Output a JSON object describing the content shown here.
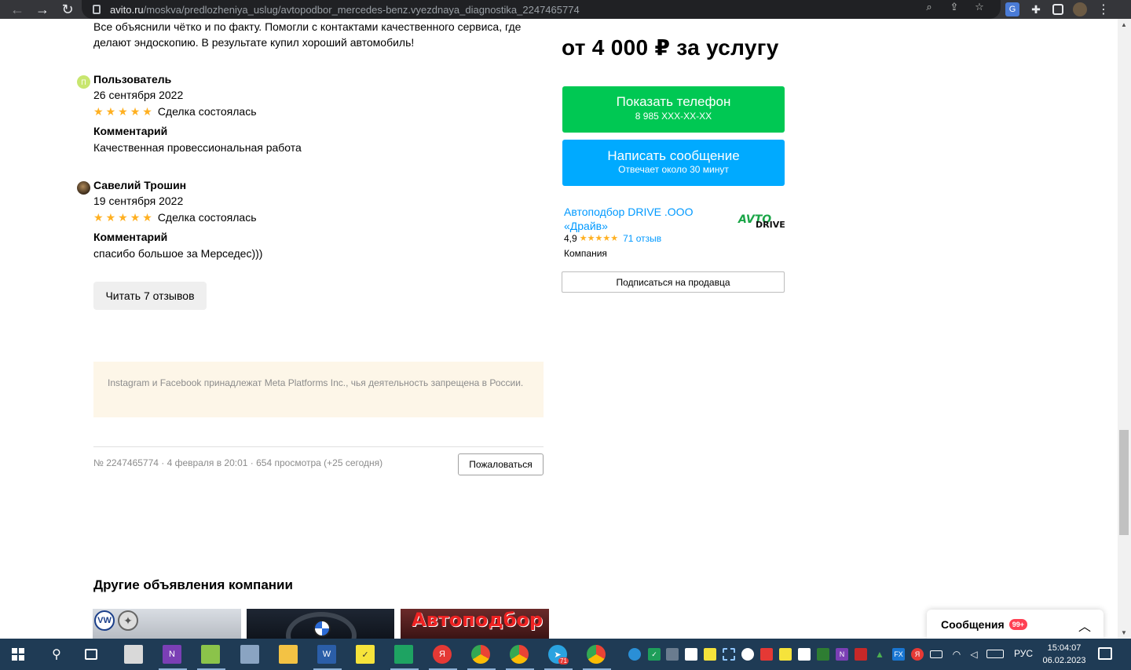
{
  "browser": {
    "url_host": "avito.ru",
    "url_path": "/moskva/predlozheniya_uslug/avtopodbor_mercedes-benz.vyezdnaya_diagnostika_2247465774"
  },
  "reviews": {
    "intro_text": "Все объяснили чётко и по факту. Помогли с контактами качественного сервиса, где делают эндоскопию. В результате купил хороший автомобиль!",
    "items": [
      {
        "avatar_letter": "П",
        "author": "Пользователь",
        "date": "26 сентября 2022",
        "deal": "Сделка состоялась",
        "comment_heading": "Комментарий",
        "comment": "Качественная провессиональная работа"
      },
      {
        "author": "Савелий Трошин",
        "date": "19 сентября 2022",
        "deal": "Сделка состоялась",
        "comment_heading": "Комментарий",
        "comment": "спасибо большое за Мерседес)))"
      }
    ],
    "read_more_label": "Читать 7 отзывов"
  },
  "notice": "Instagram и Facebook принадлежат Meta Platforms Inc., чья деятельность запрещена в России.",
  "listing_meta": "№ 2247465774 · 4 февраля в 20:01 · 654 просмотра (+25 сегодня)",
  "report_label": "Пожаловаться",
  "other_ads": {
    "title": "Другие объявления компании",
    "thumb3_text": "Автоподбор"
  },
  "sidebar": {
    "price": "от 4 000 ₽ за услугу",
    "phone_button": {
      "label": "Показать телефон",
      "sub": "8 985 XXX-XX-XX",
      "color": "#00c853"
    },
    "message_button": {
      "label": "Написать сообщение",
      "sub": "Отвечает около 30 минут",
      "color": "#00aaff"
    },
    "seller": {
      "name": "Автоподбор DRIVE .ООО «Драйв»",
      "rating": "4,9",
      "stars": 5,
      "reviews_link": "71 отзыв",
      "type": "Компания",
      "logo_top": "AVTO",
      "logo_bottom": "DRIVE"
    },
    "subscribe_label": "Подписаться на продавца"
  },
  "messages_widget": {
    "label": "Сообщения",
    "badge": "99+"
  },
  "taskbar": {
    "language": "РУС",
    "time": "15:04:07",
    "date": "06.02.2023",
    "telegram_badge": "71"
  }
}
